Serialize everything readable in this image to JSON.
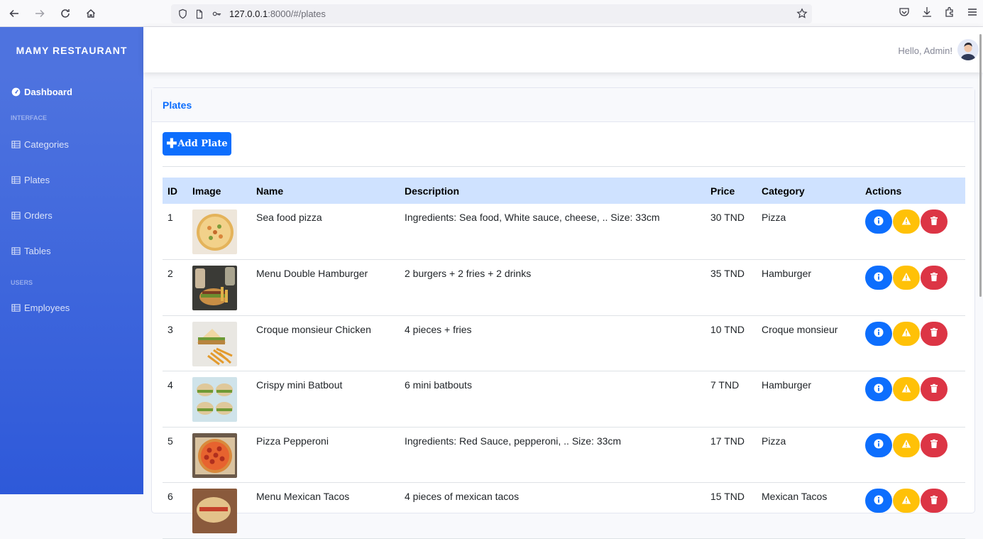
{
  "browser": {
    "url_host": "127.0.0.1",
    "url_rest": ":8000/#/plates"
  },
  "sidebar": {
    "brand": "MAMY RESTAURANT",
    "dashboard": "Dashboard",
    "heading_interface": "INTERFACE",
    "items": [
      {
        "label": "Categories",
        "icon": "table-icon"
      },
      {
        "label": "Plates",
        "icon": "table-icon"
      },
      {
        "label": "Orders",
        "icon": "table-icon"
      },
      {
        "label": "Tables",
        "icon": "table-icon"
      }
    ],
    "heading_users": "USERS",
    "employees": "Employees"
  },
  "topbar": {
    "greeting": "Hello, Admin!"
  },
  "card": {
    "title": "Plates",
    "add_button": "Add Plate"
  },
  "table": {
    "columns": [
      "ID",
      "Image",
      "Name",
      "Description",
      "Price",
      "Category",
      "Actions"
    ],
    "rows": [
      {
        "id": "1",
        "name": "Sea food pizza",
        "description": "Ingredients: Sea food, White sauce, cheese, .. Size: 33cm",
        "price": "30 TND",
        "category": "Pizza"
      },
      {
        "id": "2",
        "name": "Menu Double Hamburger",
        "description": "2 burgers + 2 fries + 2 drinks",
        "price": "35 TND",
        "category": "Hamburger"
      },
      {
        "id": "3",
        "name": "Croque monsieur Chicken",
        "description": "4 pieces + fries",
        "price": "10 TND",
        "category": "Croque monsieur"
      },
      {
        "id": "4",
        "name": "Crispy mini Batbout",
        "description": "6 mini batbouts",
        "price": "7 TND",
        "category": "Hamburger"
      },
      {
        "id": "5",
        "name": "Pizza Pepperoni",
        "description": "Ingredients: Red Sauce, pepperoni, .. Size: 33cm",
        "price": "17 TND",
        "category": "Pizza"
      },
      {
        "id": "6",
        "name": "Menu Mexican Tacos",
        "description": "4 pieces of mexican tacos",
        "price": "15 TND",
        "category": "Mexican Tacos"
      }
    ]
  },
  "colors": {
    "primary": "#0d6efd",
    "warning": "#ffc107",
    "danger": "#dc3545",
    "sidebar": "#4e73df",
    "table_header": "#cfe2ff"
  }
}
